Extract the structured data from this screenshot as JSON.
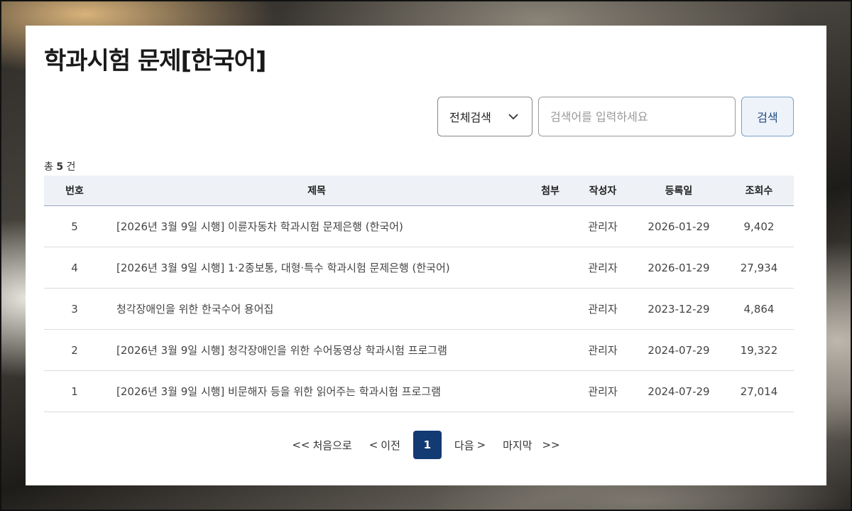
{
  "page": {
    "title": "학과시험 문제[한국어]"
  },
  "search": {
    "select_value": "전체검색",
    "placeholder": "검색어를 입력하세요",
    "button_label": "검색"
  },
  "summary": {
    "prefix": "총",
    "count": "5",
    "suffix": "건"
  },
  "table": {
    "headers": {
      "num": "번호",
      "title": "제목",
      "attach": "첨부",
      "author": "작성자",
      "date": "등록일",
      "views": "조회수"
    },
    "rows": [
      {
        "num": "5",
        "title": "[2026년 3월 9일 시행] 이륜자동차 학과시험 문제은행 (한국어)",
        "attach": "",
        "author": "관리자",
        "date": "2026-01-29",
        "views": "9,402"
      },
      {
        "num": "4",
        "title": "[2026년 3월 9일 시행] 1·2종보통, 대형·특수 학과시험 문제은행 (한국어)",
        "attach": "",
        "author": "관리자",
        "date": "2026-01-29",
        "views": "27,934"
      },
      {
        "num": "3",
        "title": "청각장애인을 위한 한국수어 용어집",
        "attach": "",
        "author": "관리자",
        "date": "2023-12-29",
        "views": "4,864"
      },
      {
        "num": "2",
        "title": "[2026년 3월 9일 시행] 청각장애인을 위한 수어동영상 학과시험 프로그램",
        "attach": "",
        "author": "관리자",
        "date": "2024-07-29",
        "views": "19,322"
      },
      {
        "num": "1",
        "title": "[2026년 3월 9일 시행] 비문해자 등을 위한 읽어주는 학과시험 프로그램",
        "attach": "",
        "author": "관리자",
        "date": "2024-07-29",
        "views": "27,014"
      }
    ]
  },
  "pagination": {
    "first_label": "처음으로",
    "prev_label": "이전",
    "current": "1",
    "next_label": "다음",
    "last_label": "마지막"
  }
}
